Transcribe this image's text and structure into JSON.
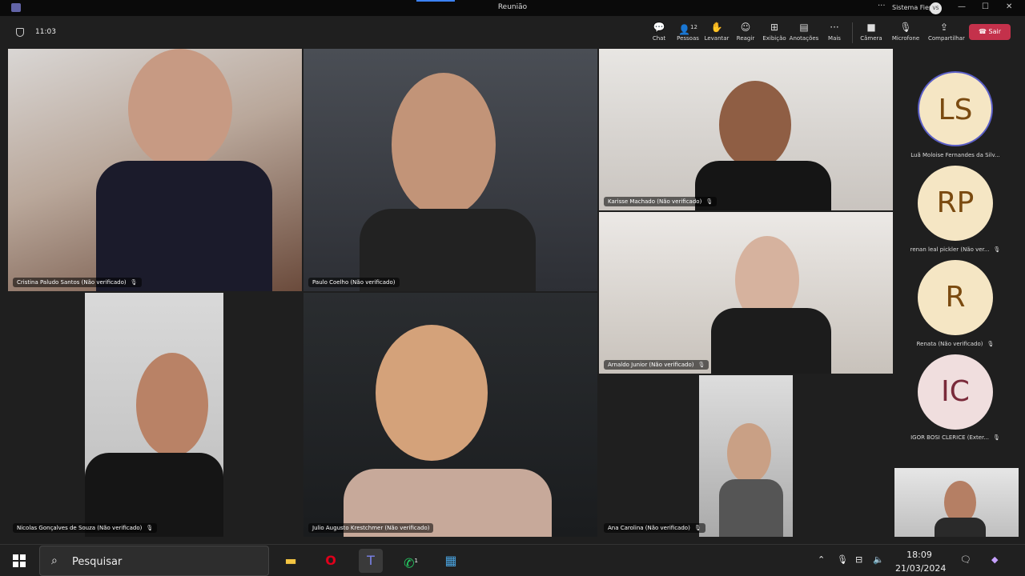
{
  "window": {
    "title": "Reunião",
    "org": "Sistema Fiep",
    "user_initials": "VS"
  },
  "toolbar": {
    "timer": "11:03",
    "buttons": [
      {
        "label": "Chat",
        "icon": "chat-icon"
      },
      {
        "label": "Pessoas",
        "icon": "people-icon",
        "badge": "12"
      },
      {
        "label": "Levantar",
        "icon": "raise-hand-icon"
      },
      {
        "label": "Reagir",
        "icon": "react-icon"
      },
      {
        "label": "Exibição",
        "icon": "view-icon"
      },
      {
        "label": "Anotações",
        "icon": "notes-icon"
      },
      {
        "label": "Mais",
        "icon": "more-icon"
      },
      {
        "label": "Câmera",
        "icon": "camera-icon"
      },
      {
        "label": "Microfone",
        "icon": "microphone-off-icon"
      },
      {
        "label": "Compartilhar",
        "icon": "share-icon"
      }
    ],
    "leave_label": "Sair"
  },
  "tiles": [
    {
      "name": "Cristina Paludo Santos (Não verificado)"
    },
    {
      "name": "Paulo Coelho (Não verificado)"
    },
    {
      "name": "Karisse Machado (Não verificado)"
    },
    {
      "name": "Arnaldo Junior (Não verificado)"
    },
    {
      "name": "Nicolas Gonçalves de Souza (Não verificado)"
    },
    {
      "name": "Julio Augusto Krestchmer (Não verificado)"
    },
    {
      "name": "Ana Carolina (Não verificado)"
    }
  ],
  "participants": [
    {
      "initials": "LS",
      "name": "Luã Moloise Fernandes da Silv..."
    },
    {
      "initials": "RP",
      "name": "renan leal pickler (Não ver..."
    },
    {
      "initials": "R",
      "name": "Renata (Não verificado)"
    },
    {
      "initials": "IC",
      "name": "IGOR BOSI CLERICE (Exter..."
    }
  ],
  "taskbar": {
    "search_placeholder": "Pesquisar",
    "time": "18:09",
    "date": "21/03/2024",
    "whatsapp_badge": "1"
  },
  "colors": {
    "leave": "#c4314b",
    "avatar_bg": "#f5e6c4",
    "avatar_ic_bg": "#f0dede"
  }
}
